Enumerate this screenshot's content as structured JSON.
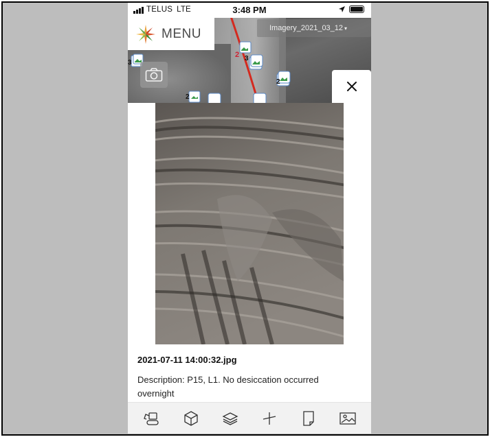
{
  "status_bar": {
    "carrier": "TELUS",
    "network": "LTE",
    "time": "3:48 PM"
  },
  "header": {
    "menu_label": "MENU",
    "imagery_layer": "Imagery_2021_03_12"
  },
  "map": {
    "markers": [
      {
        "count": "3"
      },
      {
        "count": "2"
      },
      {
        "count": "3"
      },
      {
        "count": "2"
      },
      {
        "count": "2"
      }
    ],
    "road_label": "2"
  },
  "photo_viewer": {
    "file_name": "2021-07-11 14:00:32.jpg",
    "description": "Description: P15, L1. No desiccation occurred overnight"
  },
  "toolbar": {
    "tools": [
      {
        "icon": "excavator-icon"
      },
      {
        "icon": "cube-icon"
      },
      {
        "icon": "layers-icon"
      },
      {
        "icon": "measure-icon"
      },
      {
        "icon": "note-icon"
      },
      {
        "icon": "image-icon"
      }
    ]
  },
  "colors": {
    "background": "#bdbdbd",
    "road": "#d42a1f",
    "toolbar": "#f2f2f2"
  }
}
